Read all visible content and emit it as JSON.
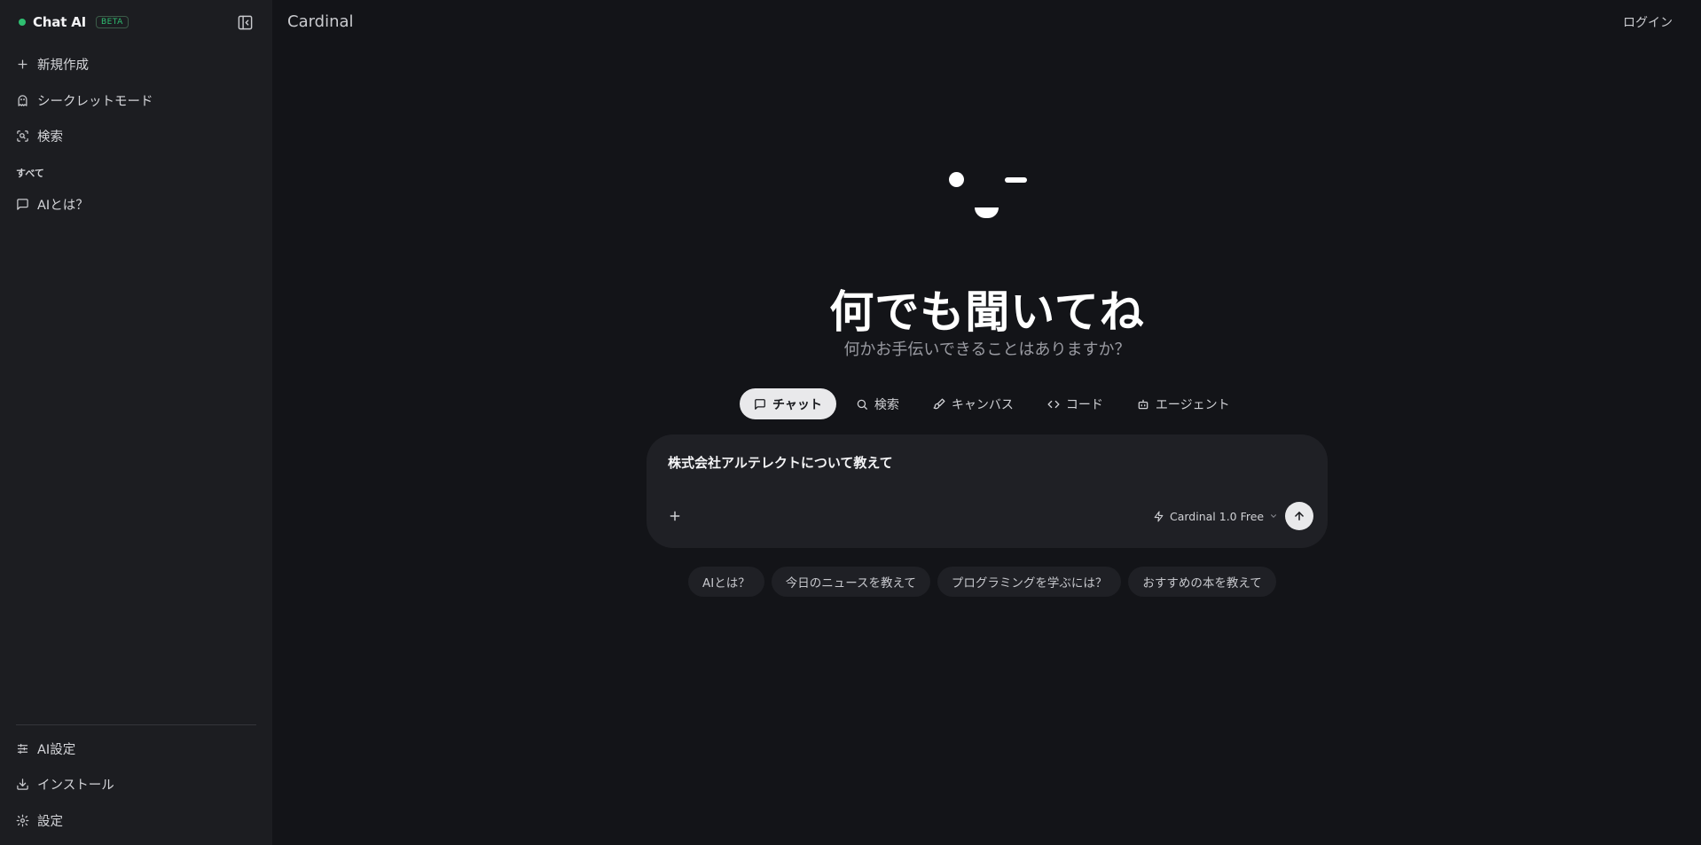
{
  "sidebar": {
    "brand_name": "Chat AI",
    "beta_badge": "BETA",
    "new_label": "新規作成",
    "secret_label": "シークレットモード",
    "search_label": "検索",
    "section_label": "すべて",
    "history": [
      {
        "label": "AIとは？"
      }
    ],
    "ai_settings_label": "AI設定",
    "install_label": "インストール",
    "settings_label": "設定"
  },
  "header": {
    "title": "Cardinal",
    "login_label": "ログイン"
  },
  "main": {
    "headline": "何でも聞いてね",
    "subheadline": "何かお手伝いできることはありますか？",
    "modes": [
      {
        "label": "チャット",
        "icon": "message-icon",
        "active": true
      },
      {
        "label": "検索",
        "icon": "search-icon"
      },
      {
        "label": "キャンバス",
        "icon": "brush-icon"
      },
      {
        "label": "コード",
        "icon": "code-icon"
      },
      {
        "label": "エージェント",
        "icon": "bot-icon"
      }
    ],
    "composer": {
      "value": "株式会社アルテレクトについて教えて",
      "model_label": "Cardinal 1.0 Free"
    },
    "suggestions": [
      {
        "label": "AIとは？"
      },
      {
        "label": "今日のニュースを教えて"
      },
      {
        "label": "プログラミングを学ぶには？"
      },
      {
        "label": "おすすめの本を教えて"
      }
    ]
  },
  "colors": {
    "background": "#131418",
    "sidebar": "#1c1d21",
    "status_green": "#2fbf71",
    "active_tab": "#e9e9eb"
  }
}
